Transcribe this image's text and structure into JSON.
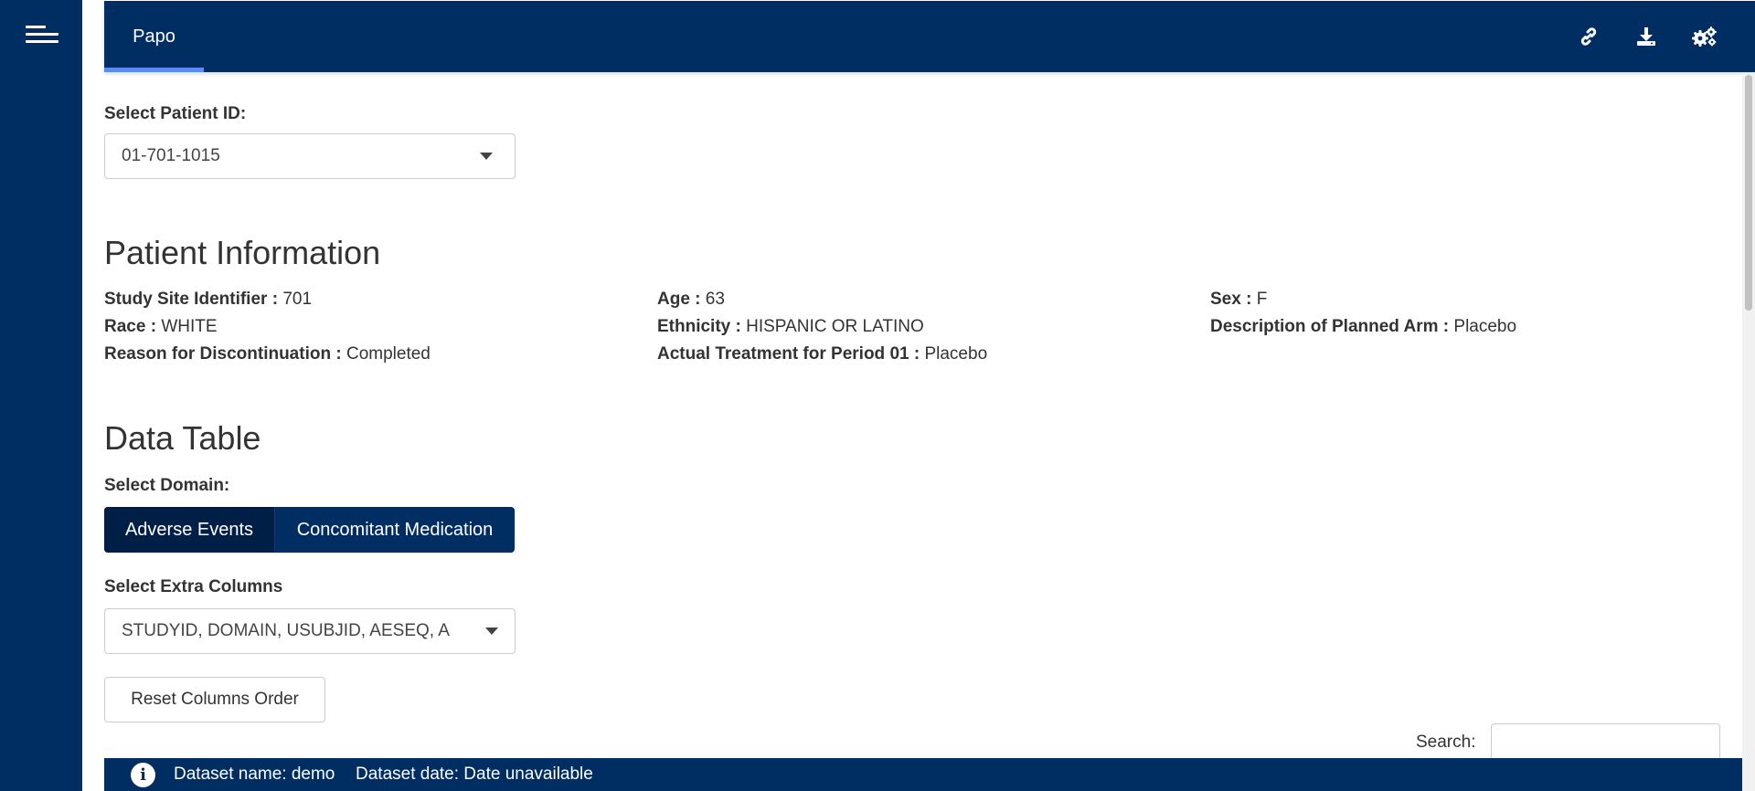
{
  "topbar": {
    "tab_label": "Papo",
    "icons": [
      "link-icon",
      "download-icon",
      "settings-icon"
    ]
  },
  "patient_select": {
    "label": "Select Patient ID:",
    "value": "01-701-1015"
  },
  "patient_info": {
    "title": "Patient Information",
    "fields": [
      {
        "label": "Study Site Identifier :",
        "value": "701"
      },
      {
        "label": "Age :",
        "value": "63"
      },
      {
        "label": "Sex :",
        "value": "F"
      },
      {
        "label": "Race :",
        "value": "WHITE"
      },
      {
        "label": "Ethnicity :",
        "value": "HISPANIC OR LATINO"
      },
      {
        "label": "Description of Planned Arm :",
        "value": "Placebo"
      },
      {
        "label": "Reason for Discontinuation :",
        "value": "Completed"
      },
      {
        "label": "Actual Treatment for Period 01 :",
        "value": "Placebo"
      }
    ]
  },
  "data_table": {
    "title": "Data Table",
    "domain_label": "Select Domain:",
    "domains": [
      {
        "label": "Adverse Events",
        "active": true
      },
      {
        "label": "Concomitant Medication",
        "active": false
      }
    ],
    "extra_columns_label": "Select Extra Columns",
    "extra_columns_value": "STUDYID, DOMAIN, USUBJID, AESEQ, A",
    "reset_label": "Reset Columns Order",
    "search_label": "Search:"
  },
  "footer": {
    "dataset_name": "Dataset name: demo",
    "dataset_date": "Dataset date: Date unavailable"
  },
  "colors": {
    "navy": "#002d62",
    "tab_underline": "#5b8def"
  }
}
